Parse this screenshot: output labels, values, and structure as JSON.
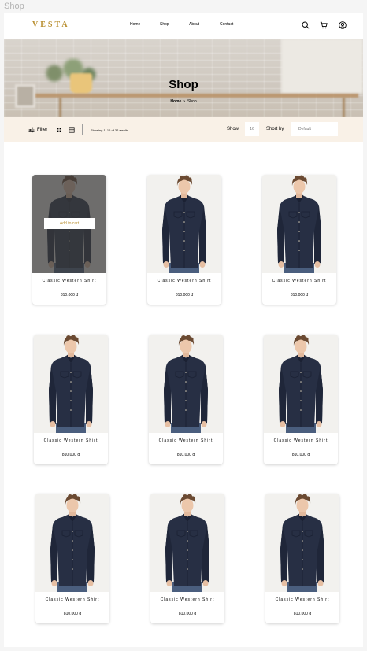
{
  "frame": {
    "label": "Shop"
  },
  "header": {
    "logo": "VESTA",
    "nav": [
      "Home",
      "Shop",
      "About",
      "Contact"
    ],
    "icons": [
      "search-icon",
      "cart-icon",
      "user-icon"
    ]
  },
  "hero": {
    "title": "Shop",
    "breadcrumb": {
      "home": "Home",
      "separator": "›",
      "current": "Shop"
    }
  },
  "filterbar": {
    "filter_label": "Filter",
    "results_text": "Showing 1–16 of 32 results",
    "show_label": "Show",
    "show_value": "16",
    "sort_label": "Short by",
    "sort_placeholder": "Default"
  },
  "hover_action": "Add to cart",
  "products": [
    {
      "name": "Classic Western Shirt",
      "price": "810.000 đ"
    },
    {
      "name": "Classic Western Shirt",
      "price": "810.000 đ"
    },
    {
      "name": "Classic Western Shirt",
      "price": "810.000 đ"
    },
    {
      "name": "Classic Western Shirt",
      "price": "810.000 đ"
    },
    {
      "name": "Classic Western Shirt",
      "price": "810.000 đ"
    },
    {
      "name": "Classic Western Shirt",
      "price": "810.000 đ"
    },
    {
      "name": "Classic Western Shirt",
      "price": "810.000 đ"
    },
    {
      "name": "Classic Western Shirt",
      "price": "810.000 đ"
    },
    {
      "name": "Classic Western Shirt",
      "price": "810.000 đ"
    }
  ],
  "colors": {
    "accent": "#b88e2f",
    "filter_bar_bg": "#f9f1e7",
    "overlay": "#3a3a3a"
  }
}
